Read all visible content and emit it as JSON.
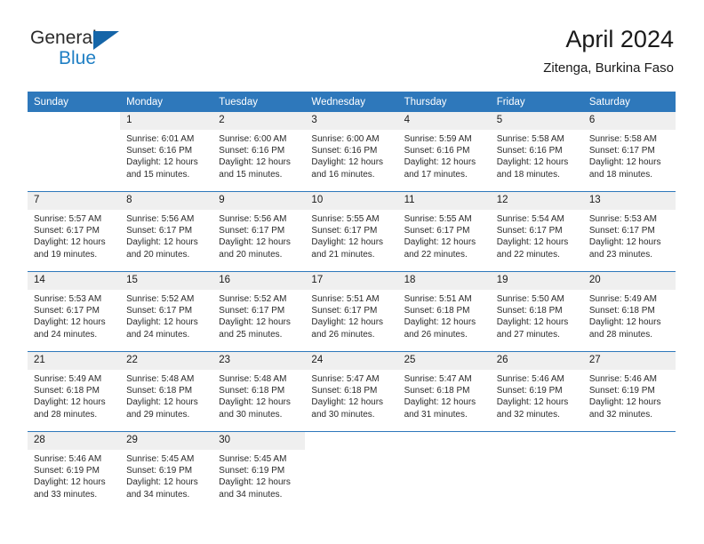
{
  "brand": {
    "line1": "General",
    "line2": "Blue",
    "accent_color": "#1f7fc4",
    "triangle_color": "#1565a8"
  },
  "header": {
    "title": "April 2024",
    "subtitle": "Zitenga, Burkina Faso"
  },
  "theme": {
    "header_row_bg": "#2e78bb",
    "daynum_bg": "#efefef",
    "text_color": "#2b2b2b"
  },
  "weekday_headers": [
    "Sunday",
    "Monday",
    "Tuesday",
    "Wednesday",
    "Thursday",
    "Friday",
    "Saturday"
  ],
  "weeks": [
    [
      {
        "day": "",
        "sunrise": "",
        "sunset": "",
        "daylight1": "",
        "daylight2": "",
        "blank": true
      },
      {
        "day": "1",
        "sunrise": "Sunrise: 6:01 AM",
        "sunset": "Sunset: 6:16 PM",
        "daylight1": "Daylight: 12 hours",
        "daylight2": "and 15 minutes."
      },
      {
        "day": "2",
        "sunrise": "Sunrise: 6:00 AM",
        "sunset": "Sunset: 6:16 PM",
        "daylight1": "Daylight: 12 hours",
        "daylight2": "and 15 minutes."
      },
      {
        "day": "3",
        "sunrise": "Sunrise: 6:00 AM",
        "sunset": "Sunset: 6:16 PM",
        "daylight1": "Daylight: 12 hours",
        "daylight2": "and 16 minutes."
      },
      {
        "day": "4",
        "sunrise": "Sunrise: 5:59 AM",
        "sunset": "Sunset: 6:16 PM",
        "daylight1": "Daylight: 12 hours",
        "daylight2": "and 17 minutes."
      },
      {
        "day": "5",
        "sunrise": "Sunrise: 5:58 AM",
        "sunset": "Sunset: 6:16 PM",
        "daylight1": "Daylight: 12 hours",
        "daylight2": "and 18 minutes."
      },
      {
        "day": "6",
        "sunrise": "Sunrise: 5:58 AM",
        "sunset": "Sunset: 6:17 PM",
        "daylight1": "Daylight: 12 hours",
        "daylight2": "and 18 minutes."
      }
    ],
    [
      {
        "day": "7",
        "sunrise": "Sunrise: 5:57 AM",
        "sunset": "Sunset: 6:17 PM",
        "daylight1": "Daylight: 12 hours",
        "daylight2": "and 19 minutes."
      },
      {
        "day": "8",
        "sunrise": "Sunrise: 5:56 AM",
        "sunset": "Sunset: 6:17 PM",
        "daylight1": "Daylight: 12 hours",
        "daylight2": "and 20 minutes."
      },
      {
        "day": "9",
        "sunrise": "Sunrise: 5:56 AM",
        "sunset": "Sunset: 6:17 PM",
        "daylight1": "Daylight: 12 hours",
        "daylight2": "and 20 minutes."
      },
      {
        "day": "10",
        "sunrise": "Sunrise: 5:55 AM",
        "sunset": "Sunset: 6:17 PM",
        "daylight1": "Daylight: 12 hours",
        "daylight2": "and 21 minutes."
      },
      {
        "day": "11",
        "sunrise": "Sunrise: 5:55 AM",
        "sunset": "Sunset: 6:17 PM",
        "daylight1": "Daylight: 12 hours",
        "daylight2": "and 22 minutes."
      },
      {
        "day": "12",
        "sunrise": "Sunrise: 5:54 AM",
        "sunset": "Sunset: 6:17 PM",
        "daylight1": "Daylight: 12 hours",
        "daylight2": "and 22 minutes."
      },
      {
        "day": "13",
        "sunrise": "Sunrise: 5:53 AM",
        "sunset": "Sunset: 6:17 PM",
        "daylight1": "Daylight: 12 hours",
        "daylight2": "and 23 minutes."
      }
    ],
    [
      {
        "day": "14",
        "sunrise": "Sunrise: 5:53 AM",
        "sunset": "Sunset: 6:17 PM",
        "daylight1": "Daylight: 12 hours",
        "daylight2": "and 24 minutes."
      },
      {
        "day": "15",
        "sunrise": "Sunrise: 5:52 AM",
        "sunset": "Sunset: 6:17 PM",
        "daylight1": "Daylight: 12 hours",
        "daylight2": "and 24 minutes."
      },
      {
        "day": "16",
        "sunrise": "Sunrise: 5:52 AM",
        "sunset": "Sunset: 6:17 PM",
        "daylight1": "Daylight: 12 hours",
        "daylight2": "and 25 minutes."
      },
      {
        "day": "17",
        "sunrise": "Sunrise: 5:51 AM",
        "sunset": "Sunset: 6:17 PM",
        "daylight1": "Daylight: 12 hours",
        "daylight2": "and 26 minutes."
      },
      {
        "day": "18",
        "sunrise": "Sunrise: 5:51 AM",
        "sunset": "Sunset: 6:18 PM",
        "daylight1": "Daylight: 12 hours",
        "daylight2": "and 26 minutes."
      },
      {
        "day": "19",
        "sunrise": "Sunrise: 5:50 AM",
        "sunset": "Sunset: 6:18 PM",
        "daylight1": "Daylight: 12 hours",
        "daylight2": "and 27 minutes."
      },
      {
        "day": "20",
        "sunrise": "Sunrise: 5:49 AM",
        "sunset": "Sunset: 6:18 PM",
        "daylight1": "Daylight: 12 hours",
        "daylight2": "and 28 minutes."
      }
    ],
    [
      {
        "day": "21",
        "sunrise": "Sunrise: 5:49 AM",
        "sunset": "Sunset: 6:18 PM",
        "daylight1": "Daylight: 12 hours",
        "daylight2": "and 28 minutes."
      },
      {
        "day": "22",
        "sunrise": "Sunrise: 5:48 AM",
        "sunset": "Sunset: 6:18 PM",
        "daylight1": "Daylight: 12 hours",
        "daylight2": "and 29 minutes."
      },
      {
        "day": "23",
        "sunrise": "Sunrise: 5:48 AM",
        "sunset": "Sunset: 6:18 PM",
        "daylight1": "Daylight: 12 hours",
        "daylight2": "and 30 minutes."
      },
      {
        "day": "24",
        "sunrise": "Sunrise: 5:47 AM",
        "sunset": "Sunset: 6:18 PM",
        "daylight1": "Daylight: 12 hours",
        "daylight2": "and 30 minutes."
      },
      {
        "day": "25",
        "sunrise": "Sunrise: 5:47 AM",
        "sunset": "Sunset: 6:18 PM",
        "daylight1": "Daylight: 12 hours",
        "daylight2": "and 31 minutes."
      },
      {
        "day": "26",
        "sunrise": "Sunrise: 5:46 AM",
        "sunset": "Sunset: 6:19 PM",
        "daylight1": "Daylight: 12 hours",
        "daylight2": "and 32 minutes."
      },
      {
        "day": "27",
        "sunrise": "Sunrise: 5:46 AM",
        "sunset": "Sunset: 6:19 PM",
        "daylight1": "Daylight: 12 hours",
        "daylight2": "and 32 minutes."
      }
    ],
    [
      {
        "day": "28",
        "sunrise": "Sunrise: 5:46 AM",
        "sunset": "Sunset: 6:19 PM",
        "daylight1": "Daylight: 12 hours",
        "daylight2": "and 33 minutes."
      },
      {
        "day": "29",
        "sunrise": "Sunrise: 5:45 AM",
        "sunset": "Sunset: 6:19 PM",
        "daylight1": "Daylight: 12 hours",
        "daylight2": "and 34 minutes."
      },
      {
        "day": "30",
        "sunrise": "Sunrise: 5:45 AM",
        "sunset": "Sunset: 6:19 PM",
        "daylight1": "Daylight: 12 hours",
        "daylight2": "and 34 minutes."
      },
      {
        "day": "",
        "sunrise": "",
        "sunset": "",
        "daylight1": "",
        "daylight2": "",
        "blank": true
      },
      {
        "day": "",
        "sunrise": "",
        "sunset": "",
        "daylight1": "",
        "daylight2": "",
        "blank": true
      },
      {
        "day": "",
        "sunrise": "",
        "sunset": "",
        "daylight1": "",
        "daylight2": "",
        "blank": true
      },
      {
        "day": "",
        "sunrise": "",
        "sunset": "",
        "daylight1": "",
        "daylight2": "",
        "blank": true
      }
    ]
  ]
}
